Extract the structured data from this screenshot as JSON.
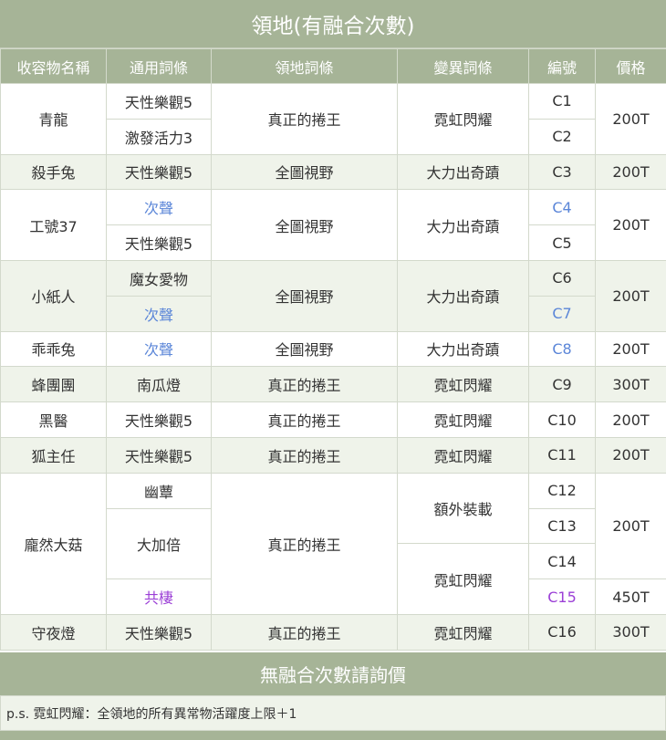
{
  "title": "領地(有融合次數)",
  "headers": [
    "收容物名稱",
    "通用詞條",
    "領地詞條",
    "變異詞條",
    "編號",
    "價格"
  ],
  "rows": [
    {
      "name": "青龍",
      "general": [
        "天性樂觀5",
        "激發活力3"
      ],
      "territory": "真正的捲王",
      "mutation": "霓虹閃耀",
      "codes": [
        "C1",
        "C2"
      ],
      "price": "200T"
    },
    {
      "name": "殺手兔",
      "general": [
        "天性樂觀5"
      ],
      "territory": "全圖視野",
      "mutation": "大力出奇蹟",
      "codes": [
        "C3"
      ],
      "price": "200T"
    },
    {
      "name": "工號37",
      "general": [
        "次聲",
        "天性樂觀5"
      ],
      "territory": "全圖視野",
      "mutation": "大力出奇蹟",
      "codes": [
        "C4",
        "C5"
      ],
      "price": "200T"
    },
    {
      "name": "小紙人",
      "general": [
        "魔女愛物",
        "次聲"
      ],
      "territory": "全圖視野",
      "mutation": "大力出奇蹟",
      "codes": [
        "C6",
        "C7"
      ],
      "price": "200T"
    },
    {
      "name": "乖乖兔",
      "general": [
        "次聲"
      ],
      "territory": "全圖視野",
      "mutation": "大力出奇蹟",
      "codes": [
        "C8"
      ],
      "price": "200T"
    },
    {
      "name": "蜂團團",
      "general": [
        "南瓜燈"
      ],
      "territory": "真正的捲王",
      "mutation": "霓虹閃耀",
      "codes": [
        "C9"
      ],
      "price": "300T"
    },
    {
      "name": "黑醫",
      "general": [
        "天性樂觀5"
      ],
      "territory": "真正的捲王",
      "mutation": "霓虹閃耀",
      "codes": [
        "C10"
      ],
      "price": "200T"
    },
    {
      "name": "狐主任",
      "general": [
        "天性樂觀5"
      ],
      "territory": "真正的捲王",
      "mutation": "霓虹閃耀",
      "codes": [
        "C11"
      ],
      "price": "200T"
    },
    {
      "name": "龐然大菇",
      "general": [
        "幽蕈",
        "大加倍",
        "共棲"
      ],
      "territory": "真正的捲王",
      "mutations": [
        "額外裝載",
        "霓虹閃耀"
      ],
      "codes": [
        "C12",
        "C13",
        "C14",
        "C15"
      ],
      "prices": [
        "200T",
        "450T"
      ]
    },
    {
      "name": "守夜燈",
      "general": [
        "天性樂觀5"
      ],
      "territory": "真正的捲王",
      "mutation": "霓虹閃耀",
      "codes": [
        "C16"
      ],
      "price": "300T"
    }
  ],
  "footer": "無融合次數請詢價",
  "note": "p.s. 霓虹閃耀：全領地的所有異常物活躍度上限＋1",
  "colors": {
    "header_bg": "#a6b497",
    "alt_row_bg": "#eff3ea",
    "blue_text": "#5b86d8",
    "purple_text": "#9b3fd6"
  }
}
